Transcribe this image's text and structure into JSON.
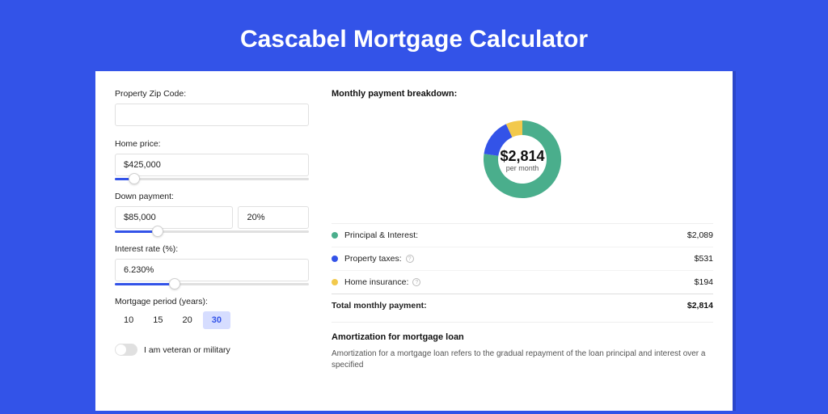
{
  "page_title": "Cascabel Mortgage Calculator",
  "form": {
    "zip": {
      "label": "Property Zip Code:",
      "value": ""
    },
    "price": {
      "label": "Home price:",
      "value": "$425,000",
      "slider_pct": 10
    },
    "down": {
      "label": "Down payment:",
      "amount": "$85,000",
      "pct": "20%",
      "slider_pct": 22
    },
    "rate": {
      "label": "Interest rate (%):",
      "value": "6.230%",
      "slider_pct": 31
    },
    "period": {
      "label": "Mortgage period (years):",
      "options": [
        "10",
        "15",
        "20",
        "30"
      ],
      "active": "30"
    },
    "military": {
      "label": "I am veteran or military",
      "on": false
    }
  },
  "breakdown": {
    "title": "Monthly payment breakdown:",
    "center_value": "$2,814",
    "center_sub": "per month",
    "items": [
      {
        "label": "Principal & Interest:",
        "value": "$2,089",
        "color": "#4aae8c",
        "info": false
      },
      {
        "label": "Property taxes:",
        "value": "$531",
        "color": "#3353e8",
        "info": true
      },
      {
        "label": "Home insurance:",
        "value": "$194",
        "color": "#f2c94c",
        "info": true
      }
    ],
    "total": {
      "label": "Total monthly payment:",
      "value": "$2,814"
    }
  },
  "chart_data": {
    "type": "pie",
    "title": "Monthly payment breakdown",
    "series": [
      {
        "name": "Principal & Interest",
        "value": 2089,
        "color": "#4aae8c"
      },
      {
        "name": "Property taxes",
        "value": 531,
        "color": "#3353e8"
      },
      {
        "name": "Home insurance",
        "value": 194,
        "color": "#f2c94c"
      }
    ],
    "center_value": "$2,814",
    "center_sub": "per month"
  },
  "amort": {
    "title": "Amortization for mortgage loan",
    "text": "Amortization for a mortgage loan refers to the gradual repayment of the loan principal and interest over a specified"
  }
}
